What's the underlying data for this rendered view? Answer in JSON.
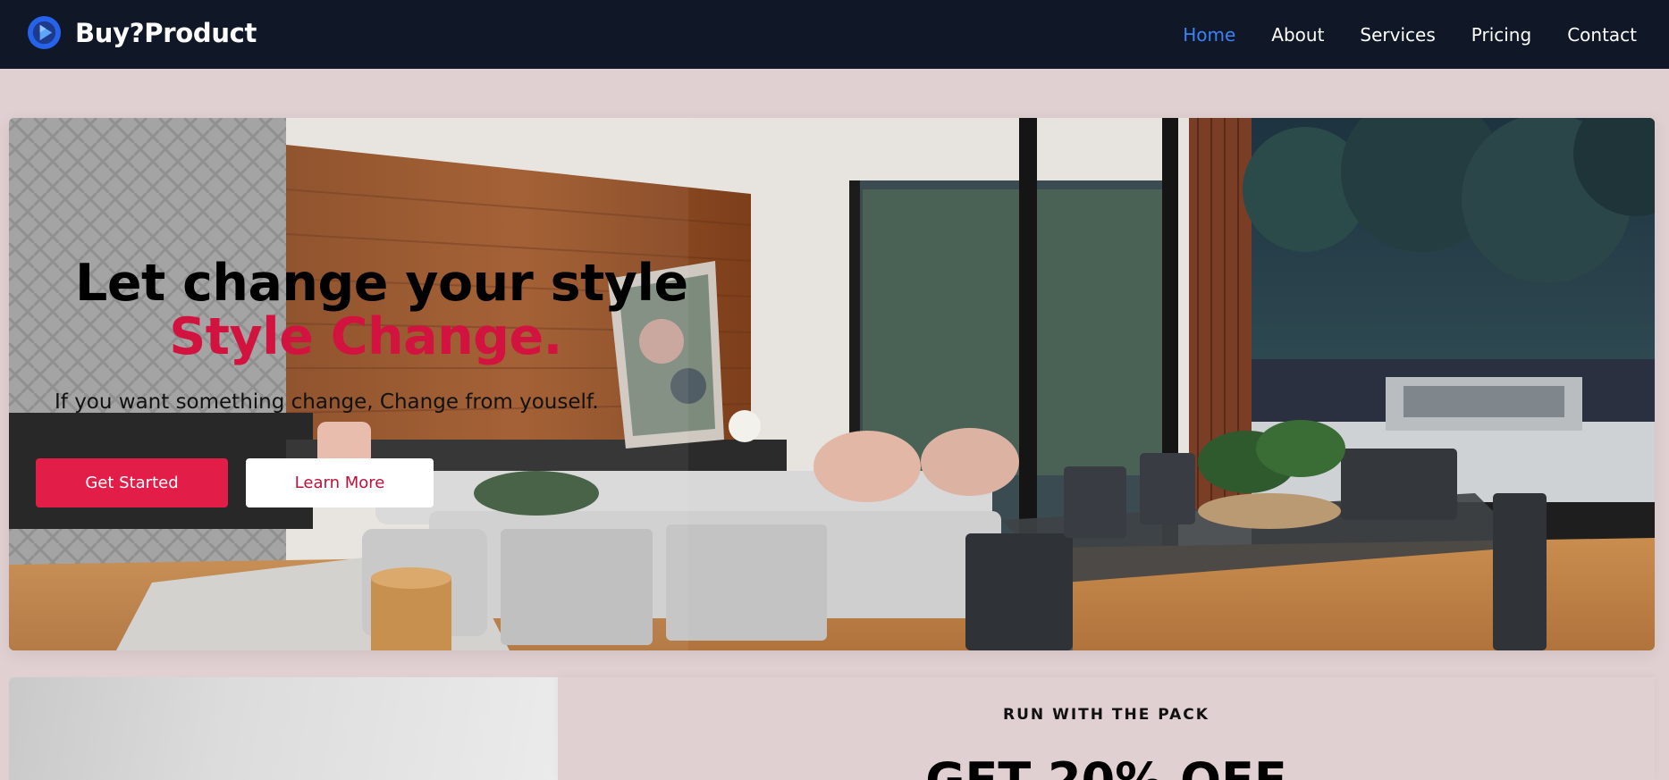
{
  "navbar": {
    "brand": "Buy?Product",
    "logo_icon": "play-logo-icon",
    "links": [
      {
        "label": "Home",
        "active": true
      },
      {
        "label": "About",
        "active": false
      },
      {
        "label": "Services",
        "active": false
      },
      {
        "label": "Pricing",
        "active": false
      },
      {
        "label": "Contact",
        "active": false
      }
    ]
  },
  "hero": {
    "title": "Let change your style",
    "title_accent": "Style Change.",
    "subtitle": "If you want something change, Change from youself.",
    "primary_button": "Get Started",
    "secondary_button": "Learn More",
    "image": "modern-living-dining-room-photo"
  },
  "promo": {
    "eyebrow": "RUN WITH THE PACK",
    "title": "GET 20% OFF"
  },
  "colors": {
    "page_bg": "#e0d0d2",
    "nav_bg": "#101828",
    "nav_active": "#3b82f6",
    "accent": "#e11d48",
    "accent_text": "#d3133f"
  }
}
